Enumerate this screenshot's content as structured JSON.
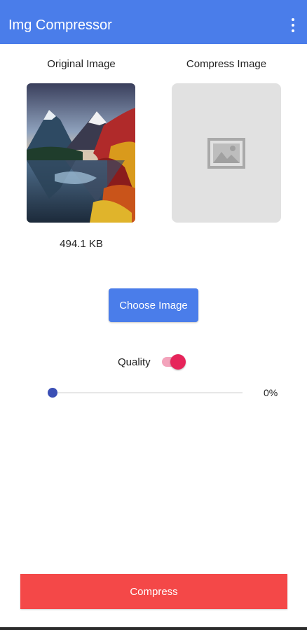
{
  "app": {
    "title": "Img Compressor",
    "menu_icon": "more-vert-icon",
    "accent": "#4a7dea"
  },
  "images": {
    "original_label": "Original Image",
    "compress_label": "Compress Image",
    "original_size": "494.1 KB",
    "placeholder_icon": "image-placeholder-icon"
  },
  "actions": {
    "choose_label": "Choose Image",
    "compress_label": "Compress",
    "compress_color": "#f44848"
  },
  "quality": {
    "label": "Quality",
    "enabled": true,
    "value": 0,
    "value_text": "0%"
  }
}
